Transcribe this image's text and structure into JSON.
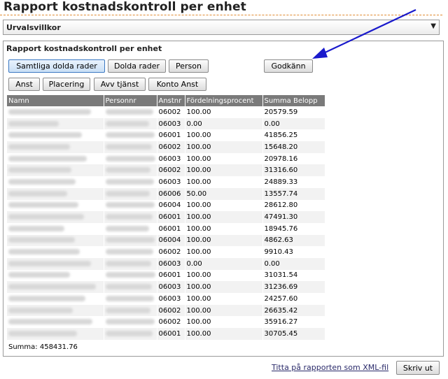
{
  "header": {
    "title": "Rapport kostnadskontroll per enhet"
  },
  "urval": {
    "label": "Urvalsvillkor",
    "arrow": "▼"
  },
  "panel": {
    "title": "Rapport kostnadskontroll per enhet"
  },
  "buttons": {
    "samtliga": "Samtliga dolda rader",
    "dolda": "Dolda rader",
    "person": "Person",
    "godkann": "Godkänn",
    "anst": "Anst",
    "placering": "Placering",
    "avv_tjanst": "Avv tjänst",
    "konto_anst": "Konto Anst"
  },
  "table": {
    "headers": [
      "Namn",
      "Personnr",
      "Anstnr",
      "Fördelningsprocent",
      "Summa Belopp"
    ],
    "rows": [
      {
        "anstnr": "06002",
        "procent": "100.00",
        "belopp": "20579.59"
      },
      {
        "anstnr": "06003",
        "procent": "0.00",
        "belopp": "0.00"
      },
      {
        "anstnr": "06001",
        "procent": "100.00",
        "belopp": "41856.25"
      },
      {
        "anstnr": "06002",
        "procent": "100.00",
        "belopp": "15648.20"
      },
      {
        "anstnr": "06003",
        "procent": "100.00",
        "belopp": "20978.16"
      },
      {
        "anstnr": "06002",
        "procent": "100.00",
        "belopp": "31316.60"
      },
      {
        "anstnr": "06003",
        "procent": "100.00",
        "belopp": "24889.33"
      },
      {
        "anstnr": "06006",
        "procent": "50.00",
        "belopp": "13557.74"
      },
      {
        "anstnr": "06004",
        "procent": "100.00",
        "belopp": "28612.80"
      },
      {
        "anstnr": "06001",
        "procent": "100.00",
        "belopp": "47491.30"
      },
      {
        "anstnr": "06001",
        "procent": "100.00",
        "belopp": "18945.76"
      },
      {
        "anstnr": "06004",
        "procent": "100.00",
        "belopp": "4862.63"
      },
      {
        "anstnr": "06002",
        "procent": "100.00",
        "belopp": "9910.43"
      },
      {
        "anstnr": "06003",
        "procent": "0.00",
        "belopp": "0.00"
      },
      {
        "anstnr": "06001",
        "procent": "100.00",
        "belopp": "31031.54"
      },
      {
        "anstnr": "06003",
        "procent": "100.00",
        "belopp": "31236.69"
      },
      {
        "anstnr": "06003",
        "procent": "100.00",
        "belopp": "24257.60"
      },
      {
        "anstnr": "06002",
        "procent": "100.00",
        "belopp": "26635.42"
      },
      {
        "anstnr": "06002",
        "procent": "100.00",
        "belopp": "35916.27"
      },
      {
        "anstnr": "06001",
        "procent": "100.00",
        "belopp": "30705.45"
      }
    ]
  },
  "summary": {
    "text": "Summa: 458431.76"
  },
  "footer": {
    "xml_link": "Titta på rapporten som XML-fil",
    "print": "Skriv ut"
  },
  "colors": {
    "accent_rule": "#e08a30",
    "header_bg": "#7a7a7a",
    "arrow": "#1a1acc"
  }
}
